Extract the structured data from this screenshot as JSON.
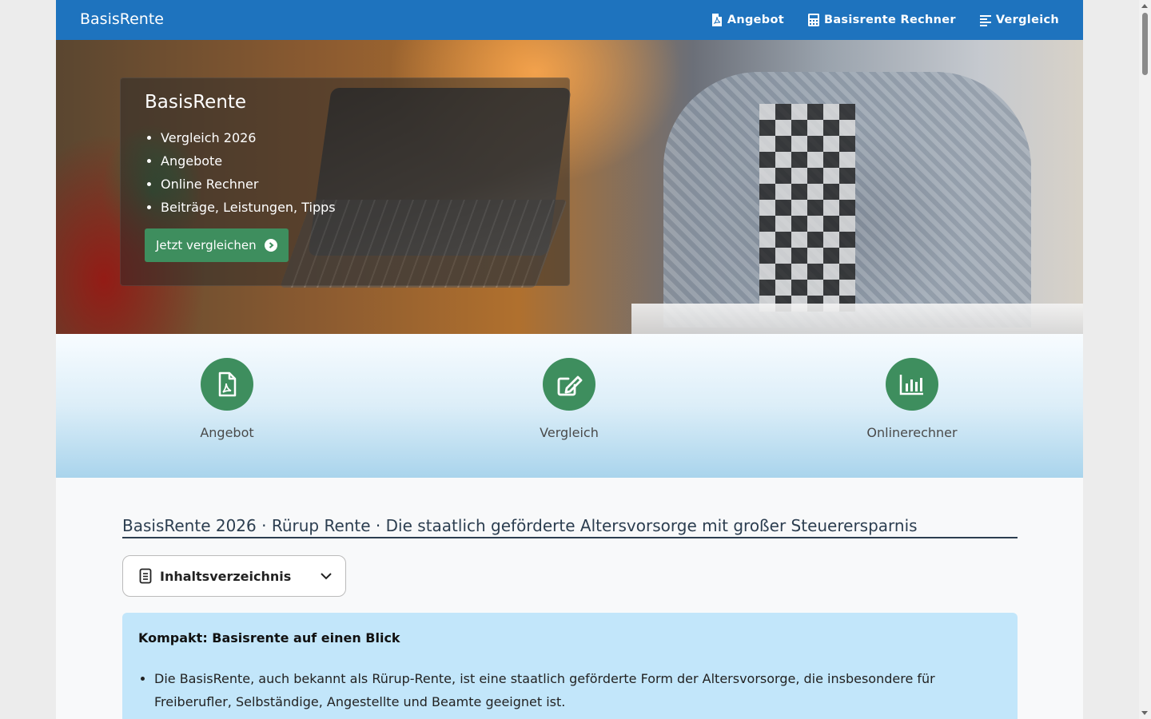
{
  "navbar": {
    "brand": "BasisRente",
    "links": [
      {
        "label": "Angebot",
        "icon": "file-pdf-icon"
      },
      {
        "label": "Basisrente Rechner",
        "icon": "calculator-icon"
      },
      {
        "label": "Vergleich",
        "icon": "align-left-icon"
      }
    ]
  },
  "hero": {
    "title": "BasisRente",
    "items": [
      "Vergleich 2026",
      "Angebote",
      "Online Rechner",
      "Beiträge, Leistungen, Tipps"
    ],
    "button_label": "Jetzt vergleichen"
  },
  "features": [
    {
      "label": "Angebot",
      "icon": "file-pdf-icon"
    },
    {
      "label": "Vergleich",
      "icon": "edit-icon"
    },
    {
      "label": "Onlinerechner",
      "icon": "bar-chart-icon"
    }
  ],
  "main": {
    "title": "BasisRente 2026 · Rürup Rente · Die staatlich geförderte Altersvorsorge mit großer Steuerersparnis",
    "toc_label": "Inhaltsverzeichnis",
    "info_title": "Kompakt: Basisrente auf einen Blick",
    "info_items": [
      "Die BasisRente, auch bekannt als Rürup-Rente, ist eine staatlich geförderte Form der Altersvorsorge, die insbesondere für Freiberufler, Selbständige, Angestellte und Beamte geeignet ist."
    ]
  },
  "colors": {
    "navbar": "#1e73be",
    "accent_green": "#3e8e5e",
    "info_bg": "#c2e6fa"
  }
}
